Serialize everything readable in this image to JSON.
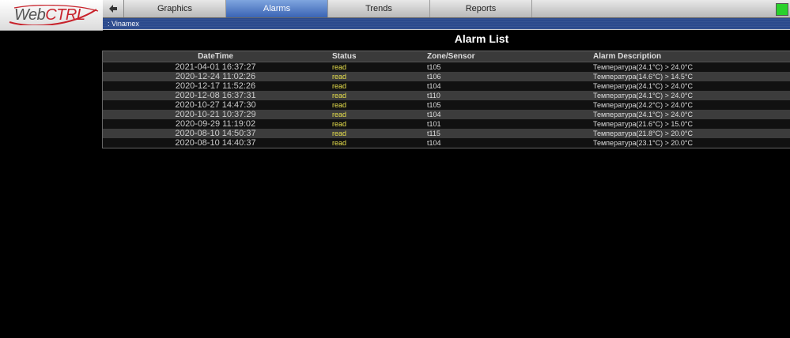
{
  "logo": {
    "text_web": "Web",
    "text_ctrl": "CTRL"
  },
  "nav": {
    "tabs": [
      {
        "label": "Graphics",
        "active": false
      },
      {
        "label": "Alarms",
        "active": true
      },
      {
        "label": "Trends",
        "active": false
      },
      {
        "label": "Reports",
        "active": false
      }
    ],
    "indicator_color": "#29d12b"
  },
  "breadcrumb": ": Vinamex",
  "page": {
    "title": "Alarm List"
  },
  "table": {
    "headers": [
      "DateTime",
      "Status",
      "Zone/Sensor",
      "Alarm Description"
    ],
    "rows": [
      [
        "2021-04-01 16:37:27",
        "read",
        "t105",
        "Температура(24.1°C) > 24.0°C"
      ],
      [
        "2020-12-24 11:02:26",
        "read",
        "t106",
        "Температура(14.6°C) > 14.5°C"
      ],
      [
        "2020-12-17 11:52:26",
        "read",
        "t104",
        "Температура(24.1°C) > 24.0°C"
      ],
      [
        "2020-12-08 16:37:31",
        "read",
        "t110",
        "Температура(24.1°C) > 24.0°C"
      ],
      [
        "2020-10-27 14:47:30",
        "read",
        "t105",
        "Температура(24.2°C) > 24.0°C"
      ],
      [
        "2020-10-21 10:37:29",
        "read",
        "t104",
        "Температура(24.1°C) > 24.0°C"
      ],
      [
        "2020-09-29 11:19:02",
        "read",
        "t101",
        "Температура(21.6°C) > 15.0°C"
      ],
      [
        "2020-08-10 14:50:37",
        "read",
        "t115",
        "Температура(21.8°C) > 20.0°C"
      ],
      [
        "2020-08-10 14:40:37",
        "read",
        "t104",
        "Температура(23.1°C) > 20.0°C"
      ]
    ]
  }
}
